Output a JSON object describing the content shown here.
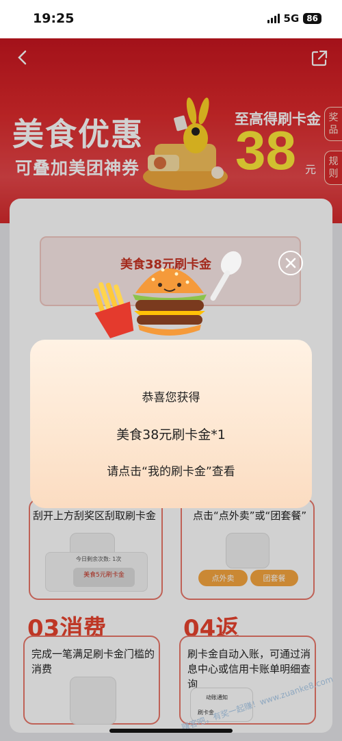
{
  "status_bar": {
    "time": "19:25",
    "network": "5G",
    "battery": "86"
  },
  "banner": {
    "title": "美食优惠",
    "subtitle": "可叠加美团神券",
    "reward_label": "至高得刷卡金",
    "reward_amount": "38",
    "reward_unit": "元",
    "tabs": [
      "奖品",
      "规则"
    ]
  },
  "scratch_card": {
    "title": "美食38元刷卡金"
  },
  "steps": [
    {
      "title": "",
      "text": "刮开上方刮奖区刮取刷卡金"
    },
    {
      "title": "",
      "text": "点击“点外卖”或“团套餐”"
    },
    {
      "title": "03消费",
      "text": "完成一笔满足刷卡金门槛的消费"
    },
    {
      "title": "04返",
      "text": "刷卡金自动入账，可通过消息中心或信用卡账单明细查询"
    }
  ],
  "mock_buttons": {
    "takeout": "点外卖",
    "group": "团套餐"
  },
  "mock_texts": {
    "remaining": "今日剩余次数: 1次",
    "card5": "美食5元刷卡金",
    "notice": "动账通知",
    "card": "刷卡金"
  },
  "popup": {
    "line1": "恭喜您获得",
    "line2": "美食38元刷卡金*1",
    "line3": "请点击“我的刷卡金”查看"
  },
  "watermark": "赚客吧，有奖一起赚！www.zuanke8.com",
  "colors": {
    "brand_red": "#d62a2c",
    "accent_yellow": "#ffe93a",
    "step_red": "#e8442f"
  }
}
